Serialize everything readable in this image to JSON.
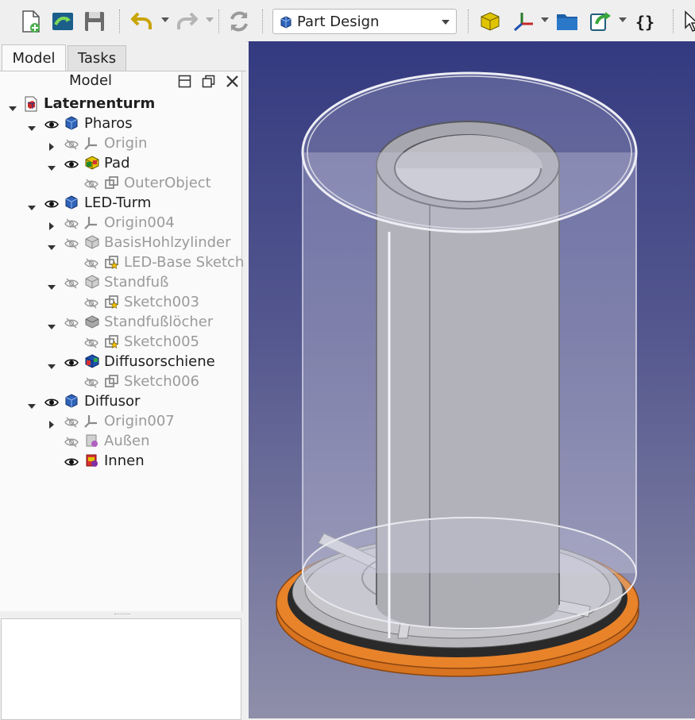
{
  "toolbar": {
    "buttons": [
      "new-file-icon",
      "open-file-icon",
      "save-icon",
      "undo-icon",
      "redo-icon",
      "refresh-icon",
      "part-icon",
      "axis-icon",
      "folder-icon",
      "link-icon",
      "macro-icon",
      "pointer-icon"
    ],
    "workbench": "Part Design"
  },
  "tabs": [
    "Model",
    "Tasks"
  ],
  "tree": {
    "header": "Model",
    "items": [
      {
        "label": "Laternenturm",
        "indent": 0,
        "arrow": "down",
        "eye": "none",
        "icon": "document",
        "hidden": false,
        "bold": true
      },
      {
        "label": "Pharos",
        "indent": 1,
        "arrow": "down",
        "eye": "open",
        "icon": "body",
        "hidden": false,
        "bold": false
      },
      {
        "label": "Origin",
        "indent": 2,
        "arrow": "right",
        "eye": "hidden",
        "icon": "origin",
        "hidden": true,
        "bold": false
      },
      {
        "label": "Pad",
        "indent": 2,
        "arrow": "down",
        "eye": "open",
        "icon": "pad",
        "hidden": false,
        "bold": false
      },
      {
        "label": "OuterObject",
        "indent": 3,
        "arrow": "none",
        "eye": "hidden",
        "icon": "sketch",
        "hidden": true,
        "bold": false
      },
      {
        "label": "LED-Turm",
        "indent": 1,
        "arrow": "down",
        "eye": "open",
        "icon": "body",
        "hidden": false,
        "bold": false
      },
      {
        "label": "Origin004",
        "indent": 2,
        "arrow": "right",
        "eye": "hidden",
        "icon": "origin",
        "hidden": true,
        "bold": false
      },
      {
        "label": "BasisHohlzylinder",
        "indent": 2,
        "arrow": "down",
        "eye": "hidden",
        "icon": "feature-grey",
        "hidden": true,
        "bold": false
      },
      {
        "label": "LED-Base Sketch",
        "indent": 3,
        "arrow": "none",
        "eye": "hidden",
        "icon": "sketch-star",
        "hidden": true,
        "bold": false
      },
      {
        "label": "Standfuß",
        "indent": 2,
        "arrow": "down",
        "eye": "hidden",
        "icon": "feature-grey",
        "hidden": true,
        "bold": false
      },
      {
        "label": "Sketch003",
        "indent": 3,
        "arrow": "none",
        "eye": "hidden",
        "icon": "sketch-star",
        "hidden": true,
        "bold": false
      },
      {
        "label": "Standfußlöcher",
        "indent": 2,
        "arrow": "down",
        "eye": "hidden",
        "icon": "pocket-grey",
        "hidden": true,
        "bold": false
      },
      {
        "label": "Sketch005",
        "indent": 3,
        "arrow": "none",
        "eye": "hidden",
        "icon": "sketch-star",
        "hidden": true,
        "bold": false
      },
      {
        "label": "Diffusorschiene",
        "indent": 2,
        "arrow": "down",
        "eye": "open",
        "icon": "feature-color",
        "hidden": false,
        "bold": false
      },
      {
        "label": "Sketch006",
        "indent": 3,
        "arrow": "none",
        "eye": "hidden",
        "icon": "sketch",
        "hidden": true,
        "bold": false
      },
      {
        "label": "Diffusor",
        "indent": 1,
        "arrow": "down",
        "eye": "open",
        "icon": "body",
        "hidden": false,
        "bold": false
      },
      {
        "label": "Origin007",
        "indent": 2,
        "arrow": "right",
        "eye": "hidden",
        "icon": "origin",
        "hidden": true,
        "bold": false
      },
      {
        "label": "Außen",
        "indent": 2,
        "arrow": "none",
        "eye": "hidden",
        "icon": "bool-grey",
        "hidden": true,
        "bold": false
      },
      {
        "label": "Innen",
        "indent": 2,
        "arrow": "none",
        "eye": "open",
        "icon": "bool-color",
        "hidden": false,
        "bold": false
      }
    ]
  },
  "colors": {
    "viewport_top": "#343a80",
    "viewport_bottom": "#8f8faa",
    "base_orange": "#e8832a",
    "model_grey": "#a8a8a8"
  }
}
